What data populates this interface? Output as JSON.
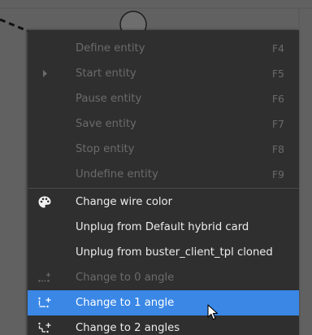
{
  "menu": {
    "items": [
      {
        "label": "Define entity",
        "shortcut": "F4",
        "icon": "",
        "state": "disabled"
      },
      {
        "label": "Start entity",
        "shortcut": "F5",
        "icon": "play-icon",
        "state": "disabled"
      },
      {
        "label": "Pause entity",
        "shortcut": "F6",
        "icon": "",
        "state": "disabled"
      },
      {
        "label": "Save entity",
        "shortcut": "F7",
        "icon": "",
        "state": "disabled"
      },
      {
        "label": "Stop entity",
        "shortcut": "F8",
        "icon": "",
        "state": "disabled"
      },
      {
        "label": "Undefine entity",
        "shortcut": "F9",
        "icon": "",
        "state": "disabled"
      },
      {
        "label": "Change wire color",
        "shortcut": "",
        "icon": "palette-icon",
        "state": "enabled"
      },
      {
        "label": "Unplug from Default hybrid card",
        "shortcut": "",
        "icon": "",
        "state": "enabled"
      },
      {
        "label": "Unplug from buster_client_tpl cloned",
        "shortcut": "",
        "icon": "",
        "state": "enabled"
      },
      {
        "label": "Change to 0 angle",
        "shortcut": "",
        "icon": "angle-0-icon",
        "state": "disabled"
      },
      {
        "label": "Change to 1 angle",
        "shortcut": "",
        "icon": "angle-1-icon",
        "state": "selected"
      },
      {
        "label": "Change to 2 angles",
        "shortcut": "",
        "icon": "angle-2-icon",
        "state": "enabled"
      }
    ]
  },
  "colors": {
    "menu_background": "#2f2f2f",
    "selection": "#3a87e6",
    "disabled_text": "#6b6b6b",
    "enabled_text": "#ececec",
    "canvas_background": "#616161"
  }
}
